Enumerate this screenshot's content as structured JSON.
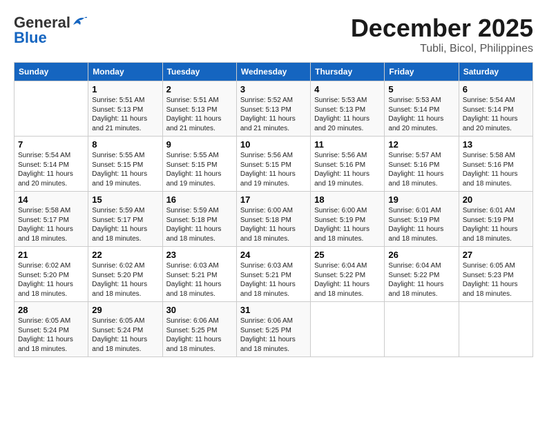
{
  "header": {
    "logo_general": "General",
    "logo_blue": "Blue",
    "month": "December 2025",
    "location": "Tubli, Bicol, Philippines"
  },
  "days_of_week": [
    "Sunday",
    "Monday",
    "Tuesday",
    "Wednesday",
    "Thursday",
    "Friday",
    "Saturday"
  ],
  "weeks": [
    [
      null,
      {
        "day": 1,
        "sunrise": "5:51 AM",
        "sunset": "5:13 PM",
        "daylight": "11 hours and 21 minutes."
      },
      {
        "day": 2,
        "sunrise": "5:51 AM",
        "sunset": "5:13 PM",
        "daylight": "11 hours and 21 minutes."
      },
      {
        "day": 3,
        "sunrise": "5:52 AM",
        "sunset": "5:13 PM",
        "daylight": "11 hours and 21 minutes."
      },
      {
        "day": 4,
        "sunrise": "5:53 AM",
        "sunset": "5:13 PM",
        "daylight": "11 hours and 20 minutes."
      },
      {
        "day": 5,
        "sunrise": "5:53 AM",
        "sunset": "5:14 PM",
        "daylight": "11 hours and 20 minutes."
      },
      {
        "day": 6,
        "sunrise": "5:54 AM",
        "sunset": "5:14 PM",
        "daylight": "11 hours and 20 minutes."
      }
    ],
    [
      {
        "day": 7,
        "sunrise": "5:54 AM",
        "sunset": "5:14 PM",
        "daylight": "11 hours and 20 minutes."
      },
      {
        "day": 8,
        "sunrise": "5:55 AM",
        "sunset": "5:15 PM",
        "daylight": "11 hours and 19 minutes."
      },
      {
        "day": 9,
        "sunrise": "5:55 AM",
        "sunset": "5:15 PM",
        "daylight": "11 hours and 19 minutes."
      },
      {
        "day": 10,
        "sunrise": "5:56 AM",
        "sunset": "5:15 PM",
        "daylight": "11 hours and 19 minutes."
      },
      {
        "day": 11,
        "sunrise": "5:56 AM",
        "sunset": "5:16 PM",
        "daylight": "11 hours and 19 minutes."
      },
      {
        "day": 12,
        "sunrise": "5:57 AM",
        "sunset": "5:16 PM",
        "daylight": "11 hours and 18 minutes."
      },
      {
        "day": 13,
        "sunrise": "5:58 AM",
        "sunset": "5:16 PM",
        "daylight": "11 hours and 18 minutes."
      }
    ],
    [
      {
        "day": 14,
        "sunrise": "5:58 AM",
        "sunset": "5:17 PM",
        "daylight": "11 hours and 18 minutes."
      },
      {
        "day": 15,
        "sunrise": "5:59 AM",
        "sunset": "5:17 PM",
        "daylight": "11 hours and 18 minutes."
      },
      {
        "day": 16,
        "sunrise": "5:59 AM",
        "sunset": "5:18 PM",
        "daylight": "11 hours and 18 minutes."
      },
      {
        "day": 17,
        "sunrise": "6:00 AM",
        "sunset": "5:18 PM",
        "daylight": "11 hours and 18 minutes."
      },
      {
        "day": 18,
        "sunrise": "6:00 AM",
        "sunset": "5:19 PM",
        "daylight": "11 hours and 18 minutes."
      },
      {
        "day": 19,
        "sunrise": "6:01 AM",
        "sunset": "5:19 PM",
        "daylight": "11 hours and 18 minutes."
      },
      {
        "day": 20,
        "sunrise": "6:01 AM",
        "sunset": "5:19 PM",
        "daylight": "11 hours and 18 minutes."
      }
    ],
    [
      {
        "day": 21,
        "sunrise": "6:02 AM",
        "sunset": "5:20 PM",
        "daylight": "11 hours and 18 minutes."
      },
      {
        "day": 22,
        "sunrise": "6:02 AM",
        "sunset": "5:20 PM",
        "daylight": "11 hours and 18 minutes."
      },
      {
        "day": 23,
        "sunrise": "6:03 AM",
        "sunset": "5:21 PM",
        "daylight": "11 hours and 18 minutes."
      },
      {
        "day": 24,
        "sunrise": "6:03 AM",
        "sunset": "5:21 PM",
        "daylight": "11 hours and 18 minutes."
      },
      {
        "day": 25,
        "sunrise": "6:04 AM",
        "sunset": "5:22 PM",
        "daylight": "11 hours and 18 minutes."
      },
      {
        "day": 26,
        "sunrise": "6:04 AM",
        "sunset": "5:22 PM",
        "daylight": "11 hours and 18 minutes."
      },
      {
        "day": 27,
        "sunrise": "6:05 AM",
        "sunset": "5:23 PM",
        "daylight": "11 hours and 18 minutes."
      }
    ],
    [
      {
        "day": 28,
        "sunrise": "6:05 AM",
        "sunset": "5:24 PM",
        "daylight": "11 hours and 18 minutes."
      },
      {
        "day": 29,
        "sunrise": "6:05 AM",
        "sunset": "5:24 PM",
        "daylight": "11 hours and 18 minutes."
      },
      {
        "day": 30,
        "sunrise": "6:06 AM",
        "sunset": "5:25 PM",
        "daylight": "11 hours and 18 minutes."
      },
      {
        "day": 31,
        "sunrise": "6:06 AM",
        "sunset": "5:25 PM",
        "daylight": "11 hours and 18 minutes."
      },
      null,
      null,
      null
    ]
  ],
  "labels": {
    "sunrise": "Sunrise:",
    "sunset": "Sunset:",
    "daylight": "Daylight:"
  }
}
